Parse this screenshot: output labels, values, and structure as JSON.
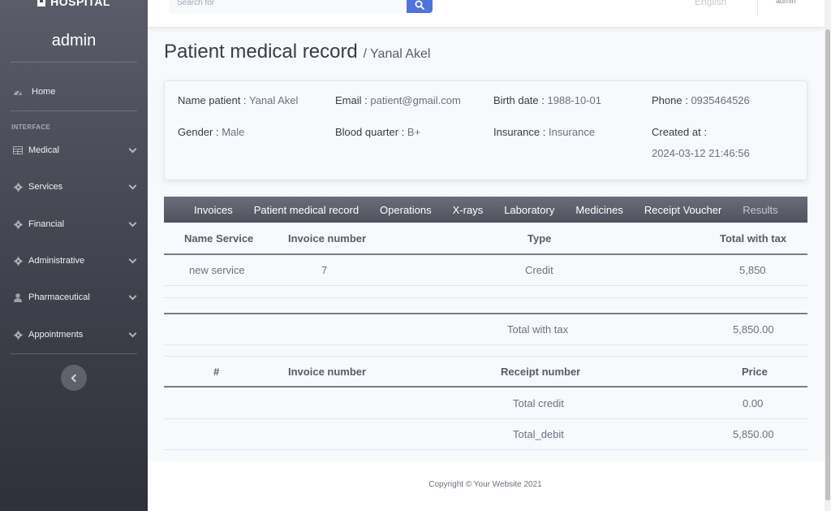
{
  "brand": "HOSPITAL",
  "sidebar": {
    "user": "admin",
    "heading": "INTERFACE",
    "home": "Home",
    "items": [
      {
        "label": "Medical",
        "icon": "table-icon"
      },
      {
        "label": "Services",
        "icon": "gear-icon"
      },
      {
        "label": "Financial",
        "icon": "gear-icon"
      },
      {
        "label": "Administrative",
        "icon": "gear-icon"
      },
      {
        "label": "Pharmaceutical",
        "icon": "user-icon"
      },
      {
        "label": "Appointments",
        "icon": "gear-icon"
      }
    ]
  },
  "topbar": {
    "search_placeholder": "Search for",
    "language": "English",
    "user": "admin"
  },
  "page": {
    "title": "Patient medical record",
    "subtitle": "/ Yanal Akel"
  },
  "patient": {
    "name_label": "Name patient :",
    "name": "Yanal Akel",
    "email_label": "Email :",
    "email": "patient@gmail.com",
    "birth_label": "Birth date :",
    "birth": "1988-10-01",
    "phone_label": "Phone :",
    "phone": "0935464526",
    "gender_label": "Gender :",
    "gender": "Male",
    "blood_label": "Blood quarter :",
    "blood": "B+",
    "insurance_label": "Insurance :",
    "insurance": "Insurance",
    "created_label": "Created at :",
    "created": "2024-03-12 21:46:56"
  },
  "tabs": [
    "Invoices",
    "Patient medical record",
    "Operations",
    "X-rays",
    "Laboratory",
    "Medicines",
    "Receipt Voucher",
    "Results"
  ],
  "invoices": {
    "headers": [
      "Name Service",
      "Invoice number",
      "Type",
      "Total with tax"
    ],
    "rows": [
      {
        "service": "new service",
        "number": "7",
        "type": "Credit",
        "total": "5,850"
      }
    ],
    "total_label": "Total with tax",
    "total_value": "5,850.00"
  },
  "receipts": {
    "headers": [
      "#",
      "Invoice number",
      "Receipt number",
      "Price"
    ],
    "credit_label": "Total credit",
    "credit_value": "0.00",
    "debit_label": "Total_debit",
    "debit_value": "5,850.00"
  },
  "footer": "Copyright © Your Website 2021",
  "colors": {
    "primary": "#4e73df",
    "sidebar": "#4a4b57"
  }
}
